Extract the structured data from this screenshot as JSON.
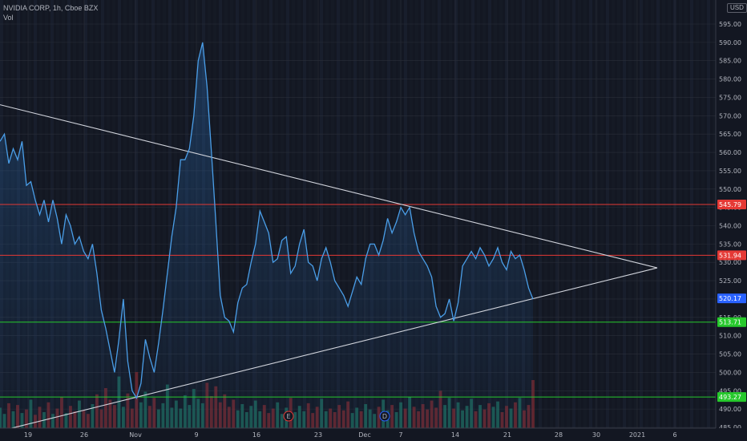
{
  "header": {
    "symbol_line": "NVIDIA CORP, 1h, Cboe BZX",
    "indicator": "Vol"
  },
  "currency": "USD",
  "colors": {
    "background": "#131722",
    "price_line": "#4a9ee8",
    "trendline": "#d1d4dc",
    "resistance": "#e53935",
    "support": "#26c92c",
    "vol_up": "#1d6b5e",
    "vol_down": "#7a2a30",
    "grid": "#2a2e39"
  },
  "chart_data": {
    "type": "line",
    "title": "NVIDIA CORP, 1h, Cboe BZX",
    "ylim": [
      482,
      597
    ],
    "y_ticks": [
      485,
      490,
      495,
      500,
      505,
      510,
      515,
      520,
      525,
      530,
      535,
      540,
      545,
      550,
      555,
      560,
      565,
      570,
      575,
      580,
      585,
      590,
      595
    ],
    "x_ticks": [
      "19",
      "26",
      "Nov",
      "9",
      "16",
      "23",
      "Dec",
      "7",
      "14",
      "21",
      "28",
      "30",
      "2021",
      "6"
    ],
    "series": [
      {
        "values": [
          563,
          565,
          557,
          561,
          558,
          563,
          551,
          552,
          547,
          543,
          547,
          541,
          547,
          542,
          535,
          543,
          540,
          535,
          537,
          533,
          531,
          535,
          527,
          517,
          512,
          506,
          500,
          509,
          520,
          503,
          495,
          493,
          497,
          509,
          504,
          500,
          508,
          517,
          527,
          537,
          545,
          558,
          558,
          561,
          570,
          585,
          590,
          578,
          560,
          541,
          521,
          515,
          514,
          511,
          519,
          523,
          524,
          530,
          535,
          544,
          541,
          538,
          530,
          531,
          536,
          537,
          527,
          529,
          535,
          539,
          530,
          529,
          525,
          531,
          534,
          530,
          525,
          523,
          521,
          518,
          522,
          526,
          524,
          531,
          535,
          535,
          532,
          536,
          542,
          538,
          541,
          545,
          543,
          545,
          538,
          533,
          531,
          529,
          526,
          518,
          515,
          516,
          520,
          514,
          519,
          529,
          531,
          533,
          531,
          534,
          532,
          529,
          531,
          534,
          530,
          528,
          533,
          531,
          532,
          528,
          523,
          520
        ],
        "volumes": [
          2.3,
          1.6,
          2.8,
          1.9,
          2.6,
          1.7,
          2.1,
          3.2,
          1.5,
          2.4,
          1.8,
          2.9,
          1.6,
          2.2,
          3.5,
          1.7,
          2.5,
          1.9,
          3.1,
          2.0,
          1.6,
          2.7,
          3.8,
          2.1,
          4.5,
          3.2,
          2.6,
          5.8,
          2.4,
          3.9,
          2.2,
          6.3,
          2.9,
          4.1,
          2.5,
          3.4,
          2.1,
          2.8,
          4.9,
          2.3,
          3.1,
          2.2,
          3.7,
          2.6,
          4.4,
          3.3,
          2.8,
          5.1,
          3.6,
          4.7,
          2.9,
          3.8,
          2.4,
          3.2,
          2.0,
          2.7,
          1.8,
          2.5,
          3.1,
          1.9,
          2.6,
          1.7,
          2.2,
          2.9,
          1.6,
          2.3,
          3.4,
          1.8,
          2.5,
          1.9,
          2.8,
          1.7,
          2.4,
          3.3,
          1.9,
          2.2,
          1.8,
          2.6,
          2.0,
          3.0,
          1.7,
          2.3,
          1.9,
          2.7,
          2.1,
          1.6,
          2.4,
          3.2,
          2.0,
          2.6,
          1.8,
          2.9,
          2.2,
          3.5,
          2.4,
          1.9,
          2.7,
          2.1,
          3.1,
          2.3,
          4.2,
          2.6,
          3.4,
          2.2,
          2.9,
          2.0,
          2.5,
          3.3,
          1.9,
          2.6,
          2.1,
          2.8,
          2.4,
          3.0,
          1.8,
          2.5,
          2.2,
          2.9,
          3.4,
          2.0,
          2.6,
          5.4
        ]
      }
    ],
    "horizontal_levels": [
      {
        "label": "545.79",
        "value": 545.79,
        "color": "#e53935"
      },
      {
        "label": "531.94",
        "value": 531.94,
        "color": "#e53935"
      },
      {
        "label": "513.71",
        "value": 513.71,
        "color": "#26c92c"
      },
      {
        "label": "493.27",
        "value": 493.27,
        "color": "#26c92c"
      }
    ],
    "last_price": {
      "label": "520.17",
      "value": 520.17,
      "color": "#2962ff"
    },
    "event_markers": [
      "E",
      "D"
    ]
  }
}
